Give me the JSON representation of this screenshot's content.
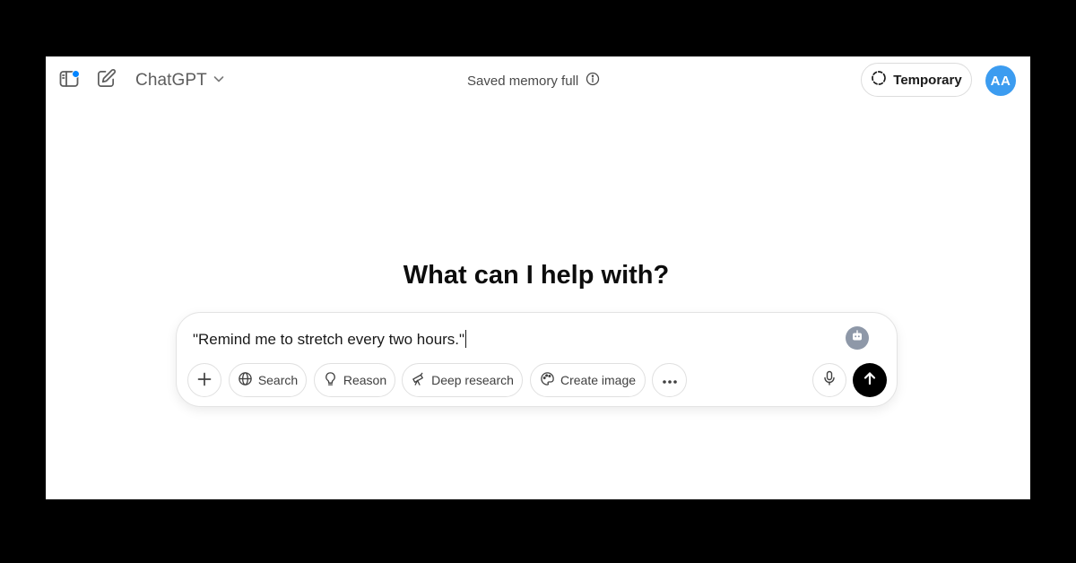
{
  "header": {
    "model_name": "ChatGPT",
    "memory_status": "Saved memory full",
    "temporary_label": "Temporary",
    "avatar_initials": "AA"
  },
  "main": {
    "heading": "What can I help with?"
  },
  "composer": {
    "input_value": "\"Remind me to stretch every two hours.\"",
    "tools": {
      "search": "Search",
      "reason": "Reason",
      "deep_research": "Deep research",
      "create_image": "Create image"
    }
  },
  "icons": {
    "sidebar": "sidebar-toggle-icon",
    "new_chat": "new-chat-icon",
    "model_chevron": "chevron-down-icon",
    "memory_info": "info-icon",
    "temporary": "dashed-circle-icon",
    "grammar": "robot-icon",
    "attach": "plus-icon",
    "search": "globe-icon",
    "reason": "lightbulb-icon",
    "deep_research": "telescope-icon",
    "create_image": "paint-palette-icon",
    "more": "more-dots-icon",
    "mic": "microphone-icon",
    "send": "arrow-up-icon"
  },
  "colors": {
    "notification_dot": "#0285ff",
    "avatar": "#3c9cf0",
    "send_button": "#000000",
    "background_frame": "#000000"
  }
}
